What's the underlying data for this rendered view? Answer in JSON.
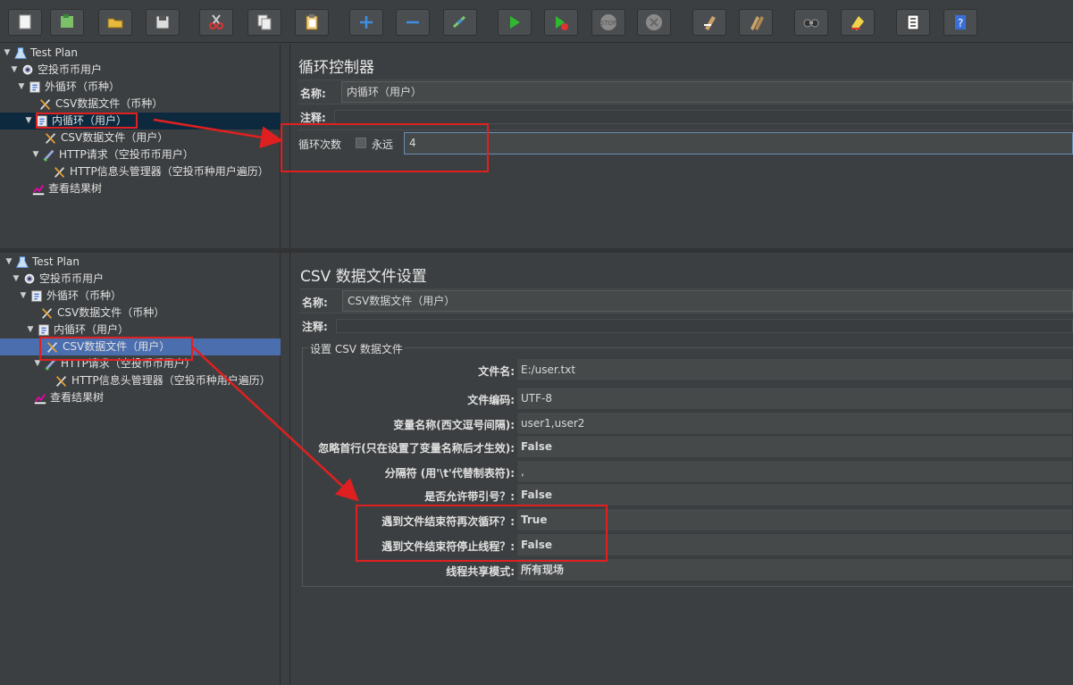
{
  "toolbar": {
    "buttons": [
      {
        "name": "new-icon"
      },
      {
        "name": "templates-icon"
      },
      {
        "name": "open-icon"
      },
      {
        "name": "save-icon"
      },
      {
        "name": "cut-icon"
      },
      {
        "name": "copy-icon"
      },
      {
        "name": "paste-icon"
      },
      {
        "name": "expand-icon"
      },
      {
        "name": "collapse-icon"
      },
      {
        "name": "toggle-icon"
      },
      {
        "name": "start-icon"
      },
      {
        "name": "start-no-timers-icon"
      },
      {
        "name": "stop-icon"
      },
      {
        "name": "shutdown-icon"
      },
      {
        "name": "clear-icon"
      },
      {
        "name": "clear-all-icon"
      },
      {
        "name": "search-icon"
      },
      {
        "name": "reset-search-icon"
      },
      {
        "name": "function-helper-icon"
      },
      {
        "name": "help-icon"
      }
    ]
  },
  "colors": {
    "accent_red": "#e02020",
    "selection_blue": "#4b6eaf",
    "selection_dark": "#0d293e"
  },
  "tree1": {
    "nodes": [
      {
        "label": "Test Plan",
        "icon": "testplan-icon"
      },
      {
        "label": "空投币币用户",
        "icon": "threadgroup-icon"
      },
      {
        "label": "外循环（币种）",
        "icon": "loop-icon"
      },
      {
        "label": "CSV数据文件（币种）",
        "icon": "csv-config-icon"
      },
      {
        "label": "内循环（用户）",
        "icon": "loop-icon"
      },
      {
        "label": "CSV数据文件（用户）",
        "icon": "csv-config-icon"
      },
      {
        "label": "HTTP请求（空投币币用户）",
        "icon": "http-sampler-icon"
      },
      {
        "label": "HTTP信息头管理器（空投币种用户遍历）",
        "icon": "header-manager-icon"
      },
      {
        "label": "查看结果树",
        "icon": "results-tree-icon"
      }
    ]
  },
  "tree2": {
    "nodes": [
      {
        "label": "Test Plan",
        "icon": "testplan-icon"
      },
      {
        "label": "空投币币用户",
        "icon": "threadgroup-icon"
      },
      {
        "label": "外循环（币种）",
        "icon": "loop-icon"
      },
      {
        "label": "CSV数据文件（币种）",
        "icon": "csv-config-icon"
      },
      {
        "label": "内循环（用户）",
        "icon": "loop-icon"
      },
      {
        "label": "CSV数据文件（用户）",
        "icon": "csv-config-icon"
      },
      {
        "label": "HTTP请求（空投币币用户）",
        "icon": "http-sampler-icon"
      },
      {
        "label": "HTTP信息头管理器（空投币种用户遍历）",
        "icon": "header-manager-icon"
      },
      {
        "label": "查看结果树",
        "icon": "results-tree-icon"
      }
    ]
  },
  "loop_panel": {
    "title": "循环控制器",
    "name_label": "名称:",
    "name_value": "内循环（用户）",
    "comment_label": "注释:",
    "loop_count_label": "循环次数",
    "forever_label": "永远",
    "loop_count_value": "4"
  },
  "csv_panel": {
    "title": "CSV 数据文件设置",
    "name_label": "名称:",
    "name_value": "CSV数据文件（用户）",
    "comment_label": "注释:",
    "group_title": "设置 CSV 数据文件",
    "rows": [
      {
        "label": "文件名:",
        "value": "E:/user.txt"
      },
      {
        "label": "文件编码:",
        "value": "UTF-8"
      },
      {
        "label": "变量名称(西文逗号间隔):",
        "value": "user1,user2"
      },
      {
        "label": "忽略首行(只在设置了变量名称后才生效):",
        "value": "False"
      },
      {
        "label": "分隔符 (用'\\t'代替制表符):",
        "value": ","
      },
      {
        "label": "是否允许带引号？:",
        "value": "False"
      },
      {
        "label": "遇到文件结束符再次循环？:",
        "value": "True"
      },
      {
        "label": "遇到文件结束符停止线程？:",
        "value": "False"
      },
      {
        "label": "线程共享模式:",
        "value": "所有现场"
      }
    ]
  }
}
